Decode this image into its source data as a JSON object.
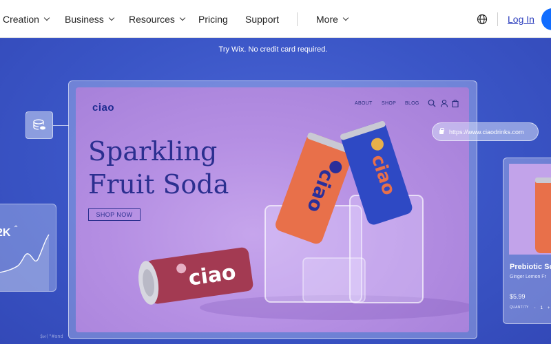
{
  "nav": {
    "items": [
      {
        "label": "Creation",
        "dropdown": true
      },
      {
        "label": "Business",
        "dropdown": true
      },
      {
        "label": "Resources",
        "dropdown": true
      },
      {
        "label": "Pricing",
        "dropdown": false
      },
      {
        "label": "Support",
        "dropdown": false
      },
      {
        "label": "More",
        "dropdown": true
      }
    ],
    "login_label": "Log In",
    "globe_icon": "globe-icon"
  },
  "hero": {
    "tagline": "Try Wix. No credit card required."
  },
  "stats_card": {
    "value": "2K",
    "trend": "up"
  },
  "caption": "$w(\"#and",
  "site_preview": {
    "logo": "ciao",
    "nav": [
      "ABOUT",
      "SHOP",
      "BLOG"
    ],
    "headline_line1": "Sparkling",
    "headline_line2": "Fruit Soda",
    "cta_label": "SHOP NOW",
    "can_text": "ciao",
    "icons": [
      "search-icon",
      "user-icon",
      "bag-icon"
    ]
  },
  "url_bar": {
    "url": "https://www.ciaodrinks.com"
  },
  "product_card": {
    "name": "Prebiotic So",
    "subtitle": "Ginger Lemon Fr",
    "price": "$5.99",
    "quantity_label": "QUANTITY",
    "quantity_value": "1",
    "minus": "-",
    "plus": "+"
  },
  "colors": {
    "brand_blue": "#116dff",
    "hero_bg": "#3a55c6",
    "site_purple": "#b58fe3",
    "heading_navy": "#2b2f8f",
    "can_orange": "#e8704a",
    "can_blue": "#2e49c4",
    "can_red": "#a33a52"
  }
}
